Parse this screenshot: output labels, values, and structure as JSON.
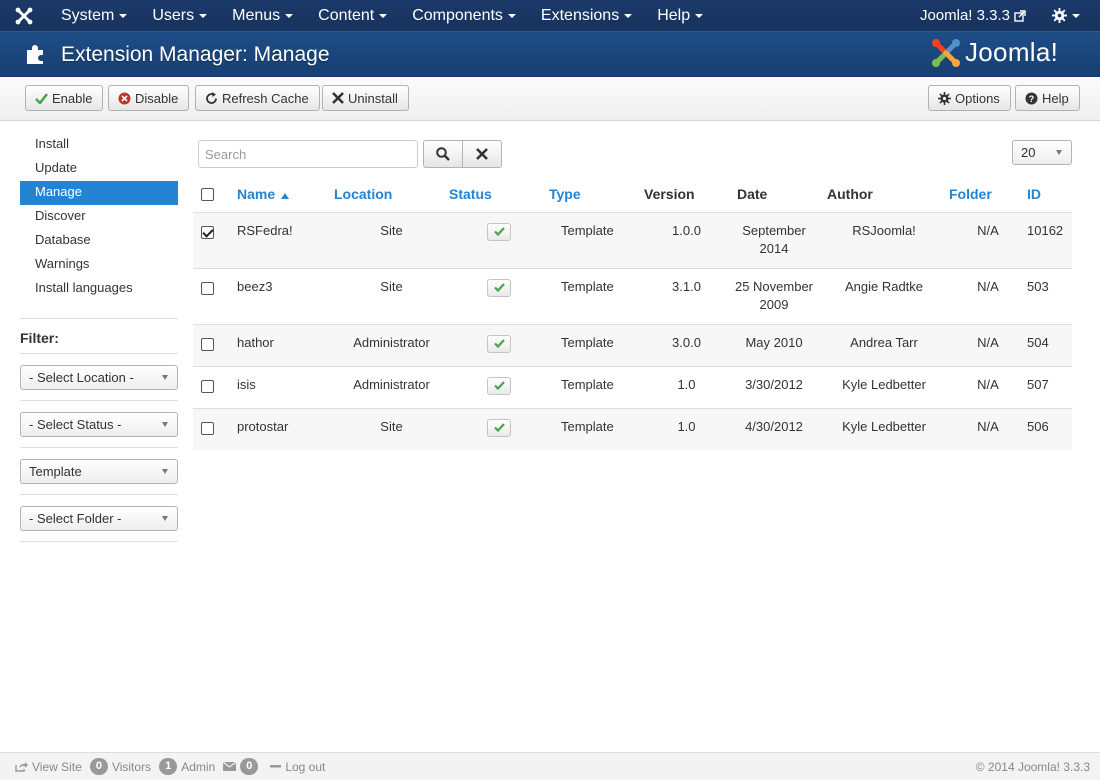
{
  "nav": {
    "menu": [
      "System",
      "Users",
      "Menus",
      "Content",
      "Components",
      "Extensions",
      "Help"
    ],
    "version_link": "Joomla! 3.3.3"
  },
  "header": {
    "title": "Extension Manager: Manage",
    "logo_text": "Joomla!"
  },
  "toolbar": {
    "enable": "Enable",
    "disable": "Disable",
    "refresh_cache": "Refresh Cache",
    "uninstall": "Uninstall",
    "options": "Options",
    "help": "Help"
  },
  "sidebar": {
    "items": [
      "Install",
      "Update",
      "Manage",
      "Discover",
      "Database",
      "Warnings",
      "Install languages"
    ],
    "active": "Manage",
    "filter_title": "Filter:",
    "filters": [
      "- Select Location -",
      "- Select Status -",
      "Template",
      "- Select Folder -"
    ]
  },
  "search": {
    "placeholder": "Search",
    "limit": "20"
  },
  "table": {
    "headers": {
      "name": "Name",
      "location": "Location",
      "status": "Status",
      "type": "Type",
      "version": "Version",
      "date": "Date",
      "author": "Author",
      "folder": "Folder",
      "id": "ID"
    },
    "rows": [
      {
        "checked": true,
        "name": "RSFedra!",
        "location": "Site",
        "type": "Template",
        "version": "1.0.0",
        "date": "September 2014",
        "author": "RSJoomla!",
        "folder": "N/A",
        "id": "10162"
      },
      {
        "checked": false,
        "name": "beez3",
        "location": "Site",
        "type": "Template",
        "version": "3.1.0",
        "date": "25 November 2009",
        "author": "Angie Radtke",
        "folder": "N/A",
        "id": "503"
      },
      {
        "checked": false,
        "name": "hathor",
        "location": "Administrator",
        "type": "Template",
        "version": "3.0.0",
        "date": "May 2010",
        "author": "Andrea Tarr",
        "folder": "N/A",
        "id": "504"
      },
      {
        "checked": false,
        "name": "isis",
        "location": "Administrator",
        "type": "Template",
        "version": "1.0",
        "date": "3/30/2012",
        "author": "Kyle Ledbetter",
        "folder": "N/A",
        "id": "507"
      },
      {
        "checked": false,
        "name": "protostar",
        "location": "Site",
        "type": "Template",
        "version": "1.0",
        "date": "4/30/2012",
        "author": "Kyle Ledbetter",
        "folder": "N/A",
        "id": "506"
      }
    ]
  },
  "footer": {
    "view_site": "View Site",
    "visitors_count": "0",
    "visitors": "Visitors",
    "admin_count": "1",
    "admin": "Admin",
    "messages_count": "0",
    "logout": "Log out",
    "copyright": "© 2014 Joomla! 3.3.3"
  },
  "colors": {
    "navbar": "#1b3a6b",
    "header": "#1f4d86",
    "accent": "#2384d3",
    "status_ok": "#46a546"
  }
}
